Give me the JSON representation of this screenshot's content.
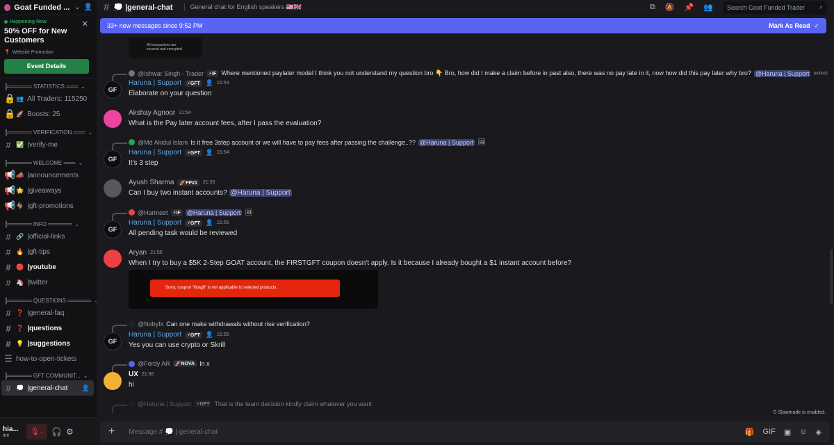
{
  "server": {
    "name": "Goat Funded ...",
    "name_full": "Goat Funded Trader"
  },
  "event": {
    "tag": "Happening Now",
    "title": "50% OFF for New Customers",
    "location": "Website Promotion",
    "button": "Event Details"
  },
  "sidebar": {
    "stats_category": "╠══════ STATISTICS ═══",
    "stats": [
      {
        "emoji": "👥",
        "label": "All Traders: 115250"
      },
      {
        "emoji": "🚀",
        "label": "Boosts: 25"
      }
    ],
    "verification_category": "╠══════ VERIFICATION ═══",
    "verify": {
      "emoji": "✅",
      "label": "|verify-me"
    },
    "welcome_category": "╠══════ WELCOME ═══",
    "welcome": [
      {
        "emoji": "📣",
        "label": "|announcements"
      },
      {
        "emoji": "🌟",
        "label": "|giveaways"
      },
      {
        "emoji": "🐐",
        "label": "|gft-promotions"
      }
    ],
    "info_category": "╠══════ INFO ══════",
    "info": [
      {
        "emoji": "🔗",
        "label": "|official-links",
        "bold": false
      },
      {
        "emoji": "🔥",
        "label": "|gft-tips",
        "bold": false
      },
      {
        "emoji": "🔴",
        "label": "|youtube",
        "bold": true
      },
      {
        "emoji": "🦄",
        "label": "|twitter",
        "bold": false
      }
    ],
    "questions_category": "╠══════ QUESTIONS ══════",
    "questions": [
      {
        "emoji": "❓",
        "label": "|general-faq",
        "bold": false
      },
      {
        "emoji": "❓",
        "label": "|questions",
        "bold": true
      },
      {
        "emoji": "💡",
        "label": "|suggestions",
        "bold": true
      },
      {
        "emoji": "",
        "label": "how-to-open-tickets",
        "bold": false
      }
    ],
    "community_category": "╠══════ GFT COMMUNIT...",
    "active_channel": {
      "emoji": "💭",
      "label": "|general-chat"
    }
  },
  "user": {
    "name": "hia...",
    "status": "ine"
  },
  "topbar": {
    "channel": "💭 |general-chat",
    "topic": "General chat for English speakers 🇺🇸🇬🇧",
    "search_placeholder": "Search Goat Funded Trader"
  },
  "newbar": {
    "text": "33+ new messages since 9:52 PM",
    "action": "Mark As Read"
  },
  "image_caption": "All transactions are secured and encrypted",
  "messages": [
    {
      "reply_name": "@Ishwar Singh - Trader",
      "reply_badge": "⚡IF",
      "reply_text": "Where mentioned paylater model I think you not understand my question bro 👇 Bro, how did I make a claim before in past also, there was no pay late in it, now how did this pay later why bro?",
      "reply_mention": "@Haruna | Support",
      "reply_edited": "(edited)",
      "author": "Haruna | Support",
      "badge": "⚡GFT",
      "time": "21:54",
      "text": "Elaborate on your question"
    },
    {
      "author": "Akshay Agnoor",
      "time": "21:54",
      "text": "What is the Pay later account fees, after I pass the evaluation?"
    },
    {
      "reply_name": "@Md Akidul Islam",
      "reply_text": "Is it free 3step account or we will have to pay fees after passing the challenge..??",
      "reply_mention": "@Haruna | Support",
      "author": "Haruna | Support",
      "badge": "⚡GFT",
      "time": "21:54",
      "text": "It's 3 step"
    },
    {
      "author": "Ayush Sharma",
      "badge": "🚀FP#1",
      "time": "21:55",
      "text": "Can I buy two instant accounts?",
      "mention": "@Haruna | Support"
    },
    {
      "reply_name": "@Harmeet",
      "reply_badge": "⚡IF",
      "reply_mention": "@Haruna | Support",
      "author": "Haruna | Support",
      "badge": "⚡GFT",
      "time": "21:55",
      "text": "All pending task would be reviewed"
    },
    {
      "author": "Aryan",
      "time": "21:55",
      "text": "When I try to buy a $5K 2-Step GOAT account, the FIRSTGFT coupon doesn't apply. Is it because I already bought a $1 instant account before?",
      "image_text": "Sorry, coupon \"firstgft\" is not applicable to selected products."
    },
    {
      "reply_name": "@Nobyfx",
      "reply_text": "Can one make withdrawals without rise verification?",
      "author": "Haruna | Support",
      "badge": "⚡GFT",
      "time": "21:55",
      "text": "Yes you can use crypto or Skrill"
    },
    {
      "reply_name": "@Ferdy AR",
      "reply_badge": "🚀NOVA",
      "reply_text": "In x",
      "author": "UX",
      "time": "21:56",
      "text": "hi"
    },
    {
      "reply_name": "@Haruna | Support",
      "reply_badge": "⚡GFT",
      "reply_text": "That is the team decision kindly claim whatever you want"
    }
  ],
  "slowmode": "Slowmode is enabled.",
  "composer": {
    "placeholder": "Message # 💭 | general-chat"
  },
  "colors": {
    "accent": "#5865f2",
    "green": "#248046",
    "mention_bg": "#3c4270",
    "support_name": "#5aa6e8"
  }
}
